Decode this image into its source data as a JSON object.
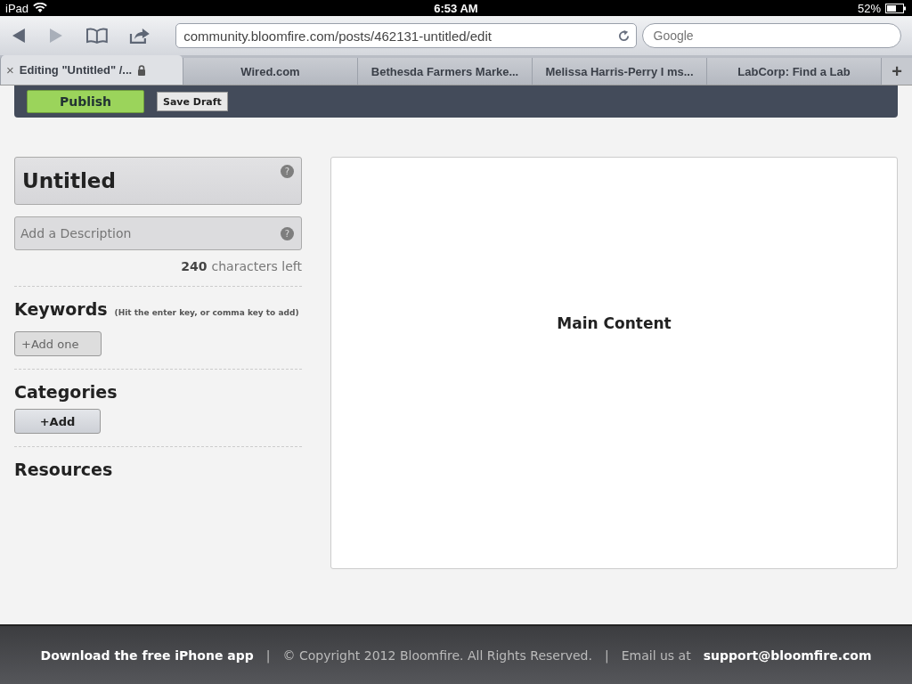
{
  "status_bar": {
    "device": "iPad",
    "time": "6:53 AM",
    "battery": "52%"
  },
  "browser": {
    "url": "community.bloomfire.com/posts/462131-untitled/edit",
    "search": {
      "placeholder": "Google"
    },
    "tabs": [
      {
        "label": "Editing \"Untitled\" /...",
        "selected": true
      },
      {
        "label": "Wired.com",
        "selected": false
      },
      {
        "label": "Bethesda Farmers Marke...",
        "selected": false
      },
      {
        "label": "Melissa Harris-Perry I ms...",
        "selected": false
      },
      {
        "label": "LabCorp: Find a Lab",
        "selected": false
      }
    ],
    "close_glyph": "×",
    "new_tab_glyph": "+"
  },
  "toolbar": {
    "buttons": [
      "Publish",
      "Save Draft"
    ]
  },
  "editor": {
    "title": "Untitled",
    "description": {
      "placeholder": "Add a Description"
    },
    "help_glyph": "?",
    "counter": "240",
    "counter_label": "characters left",
    "keywords": {
      "heading": "Keywords",
      "hint": "(Hit the enter key, or comma key to add)",
      "button": "+Add one"
    },
    "categories": {
      "heading": "Categories",
      "button": "+Add"
    },
    "resources": {
      "heading": "Resources"
    }
  },
  "main": {
    "label": "Main Content"
  },
  "footer": {
    "app_link": "Download the free iPhone app",
    "separator_1": "|",
    "copyright": "© Copyright 2012 Bloomfire. All Rights Reserved.",
    "separator_2": "|",
    "email_label": "Email us at",
    "email": "support@bloomfire.com"
  }
}
